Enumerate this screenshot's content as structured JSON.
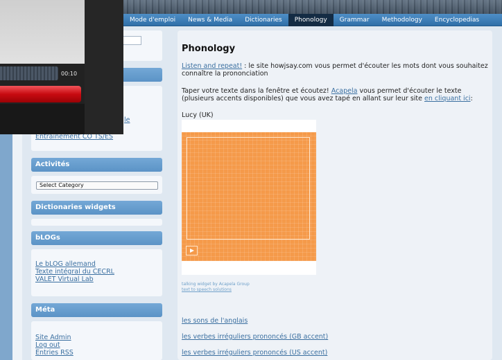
{
  "nav": {
    "items": [
      {
        "label": "Mode d'emploi"
      },
      {
        "label": "News & Media"
      },
      {
        "label": "Dictionaries"
      },
      {
        "label": "Phonology"
      },
      {
        "label": "Grammar"
      },
      {
        "label": "Methodology"
      },
      {
        "label": "Encyclopedias"
      }
    ],
    "active": "Phonology"
  },
  "video": {
    "time": "00:10"
  },
  "sidebar": {
    "partial_link": "le",
    "entrainement": "Entrainement CO TS/ES",
    "activites": {
      "title": "Activités",
      "select": "Select Category"
    },
    "dictionaries": {
      "title": "Dictionaries widgets"
    },
    "blogs": {
      "title": "bLOGs",
      "links": [
        "Le bLOG allemand",
        "Texte intégral du CECRL",
        "VALET Virtual Lab"
      ]
    },
    "meta": {
      "title": "Méta",
      "links": [
        "Site Admin",
        "Log out",
        "Entries RSS"
      ]
    }
  },
  "main": {
    "title": "Phonology",
    "p1_link": "Listen and repeat!",
    "p1_text": " : le site howjsay.com vous permet d'écouter les mots dont vous souhaitez connaître la prononciation",
    "p2_a": "Taper votre texte dans la fenêtre et écoutez! ",
    "p2_link1": "Acapela",
    "p2_b": " vous permet d'écouter le texte (plusieurs accents disponibles) que vous avez tapé en allant sur leur site ",
    "p2_link2": "en cliquant ici",
    "p2_c": ":",
    "voice": "Lucy (UK)",
    "tiny1": "talking widget by Acapela Group",
    "tiny2": "text to speech solutions",
    "links": [
      "les sons de l'anglais",
      "les verbes irréguliers prononcés (GB accent)",
      "les verbes irréguliers prononcés (US accent)"
    ]
  },
  "colors": {
    "nav": "#2f6fa8",
    "nav_active": "#142c44",
    "widget_header": "#5b93c6",
    "acapela": "#f59a4a",
    "link": "#3a6fa0",
    "player_red": "#c80b11"
  }
}
